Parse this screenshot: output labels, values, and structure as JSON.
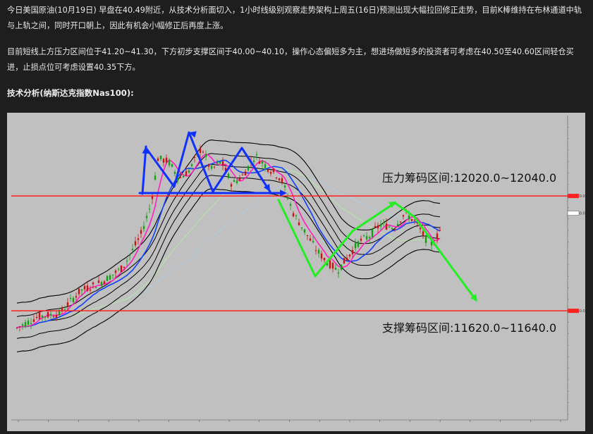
{
  "article": {
    "para1": "今日美国原油(10月19日) 早盘在40.49附近，从技术分析面切入，1小时线级别观察走势架构上周五(16日)预测出现大幅拉回修正走势，目前K棒维持在布林通道中轨与上轨之间，同时开口朝上，因此有机会小幅修正后再度上涨。",
    "para2": "目前短线上方压力区间位于41.20~41.30，下方初步支撑区间于40.00~40.10，操作心态偏短多为主，想进场做短多的投资者可考虑在40.50至40.60区间轻仓买进，止损点位可考虑设置40.35下方。",
    "heading": "技术分析(纳斯达克指数Nas100):"
  },
  "colors": {
    "page_bg": "#1e1e1e",
    "chart_bg": "#c0c0c0",
    "level_line": "#ff2020",
    "blue_arrow": "#1030ff",
    "green_arrow": "#22ee22",
    "ma_pink": "#ff20c0",
    "ma_blue": "#1040ff",
    "bollinger": "#000000",
    "candle_up": "#d01010",
    "candle_down": "#10a010"
  },
  "chart_data": {
    "type": "candlestick",
    "title": "",
    "price_ticks": [
      12020.0,
      11960.0,
      11620.0
    ],
    "resistance_zone": {
      "label": "压力筹码区间:12020.0~12040.0",
      "low": 12020.0,
      "high": 12040.0,
      "value": 12020.0
    },
    "support_zone": {
      "label": "支撑筹码区间:11620.0~11640.0",
      "low": 11620.0,
      "high": 11640.0,
      "value": 11620.0
    },
    "last_price": 11960.0,
    "ylim": [
      11240,
      12300
    ],
    "x_tick_count": 19,
    "grid": false
  }
}
